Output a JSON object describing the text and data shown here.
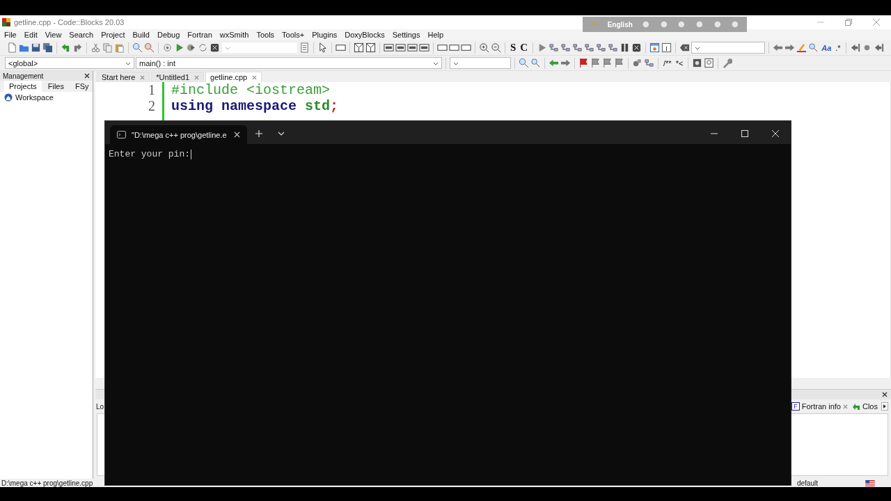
{
  "window": {
    "title": "getline.cpp - Code::Blocks 20.03"
  },
  "language_bar": {
    "language": "English"
  },
  "menu": [
    "File",
    "Edit",
    "View",
    "Search",
    "Project",
    "Build",
    "Debug",
    "Fortran",
    "wxSmith",
    "Tools",
    "Tools+",
    "Plugins",
    "DoxyBlocks",
    "Settings",
    "Help"
  ],
  "toolbar_text": [
    "S",
    "C",
    "Aa",
    ".*",
    "/**",
    "*<"
  ],
  "scope_bar": {
    "scope": "<global>",
    "function": "main() : int"
  },
  "management": {
    "title": "Management",
    "tabs": [
      {
        "label": "Projects",
        "selected": true
      },
      {
        "label": "Files",
        "selected": false
      },
      {
        "label": "FSy",
        "selected": false
      }
    ],
    "tree": [
      {
        "label": "Workspace"
      }
    ]
  },
  "editor": {
    "tabs": [
      {
        "label": "Start here",
        "selected": false
      },
      {
        "label": "*Untitled1",
        "selected": false
      },
      {
        "label": "getline.cpp",
        "selected": true
      }
    ],
    "lines": [
      {
        "number": "1",
        "tokens": [
          {
            "text": "#include <iostream>",
            "kind": "preprocessor"
          }
        ]
      },
      {
        "number": "2",
        "tokens": [
          {
            "text": "using namespace ",
            "kind": "keyword"
          },
          {
            "text": "std",
            "kind": "name"
          },
          {
            "text": ";",
            "kind": "operator"
          }
        ]
      }
    ]
  },
  "logs_panel": {
    "tabs_left": [
      {
        "label": "Lo"
      }
    ],
    "tabs_right": [
      {
        "label": "Fortran info",
        "badge": "F",
        "closable": true
      },
      {
        "label": "Clos",
        "closable": false
      }
    ]
  },
  "status_bar": {
    "path": "D:\\mega c++ prog\\getline.cpp",
    "profile": "default"
  },
  "terminal": {
    "tab_title": "\"D:\\mega c++ prog\\getline.e",
    "output": "Enter your pin:"
  }
}
